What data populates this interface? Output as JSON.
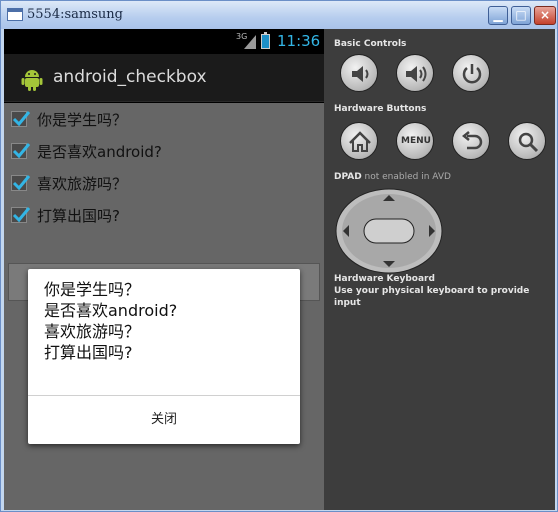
{
  "window": {
    "title": "5554:samsung",
    "min_glyph": "▁",
    "max_glyph": "□",
    "close_glyph": "×"
  },
  "status_bar": {
    "network": "3G",
    "time": "11:36"
  },
  "action_bar": {
    "app_title": "android_checkbox"
  },
  "checkboxes": [
    {
      "label": "你是学生吗？",
      "checked": true
    },
    {
      "label": "是否喜欢android?",
      "checked": true
    },
    {
      "label": "喜欢旅游吗？",
      "checked": true
    },
    {
      "label": "打算出国吗?",
      "checked": true
    }
  ],
  "dialog": {
    "lines": [
      "你是学生吗？",
      "是否喜欢android?",
      "喜欢旅游吗？",
      "打算出国吗?"
    ],
    "close_label": "关闭"
  },
  "panel": {
    "basic_controls": "Basic Controls",
    "hardware_buttons": "Hardware Buttons",
    "menu_label": "MENU",
    "dpad_title": "DPAD",
    "dpad_note": " not enabled in AVD",
    "keyboard_title": "Hardware Keyboard",
    "keyboard_note": "Use your physical keyboard to provide input"
  },
  "icons": {
    "volume_down": "volume-down-icon",
    "volume_up": "volume-up-icon",
    "power": "power-icon",
    "home": "home-icon",
    "back": "back-icon",
    "search": "search-icon"
  },
  "colors": {
    "accent_time": "#33b5e5",
    "checkbox_check": "#33b5e5"
  }
}
